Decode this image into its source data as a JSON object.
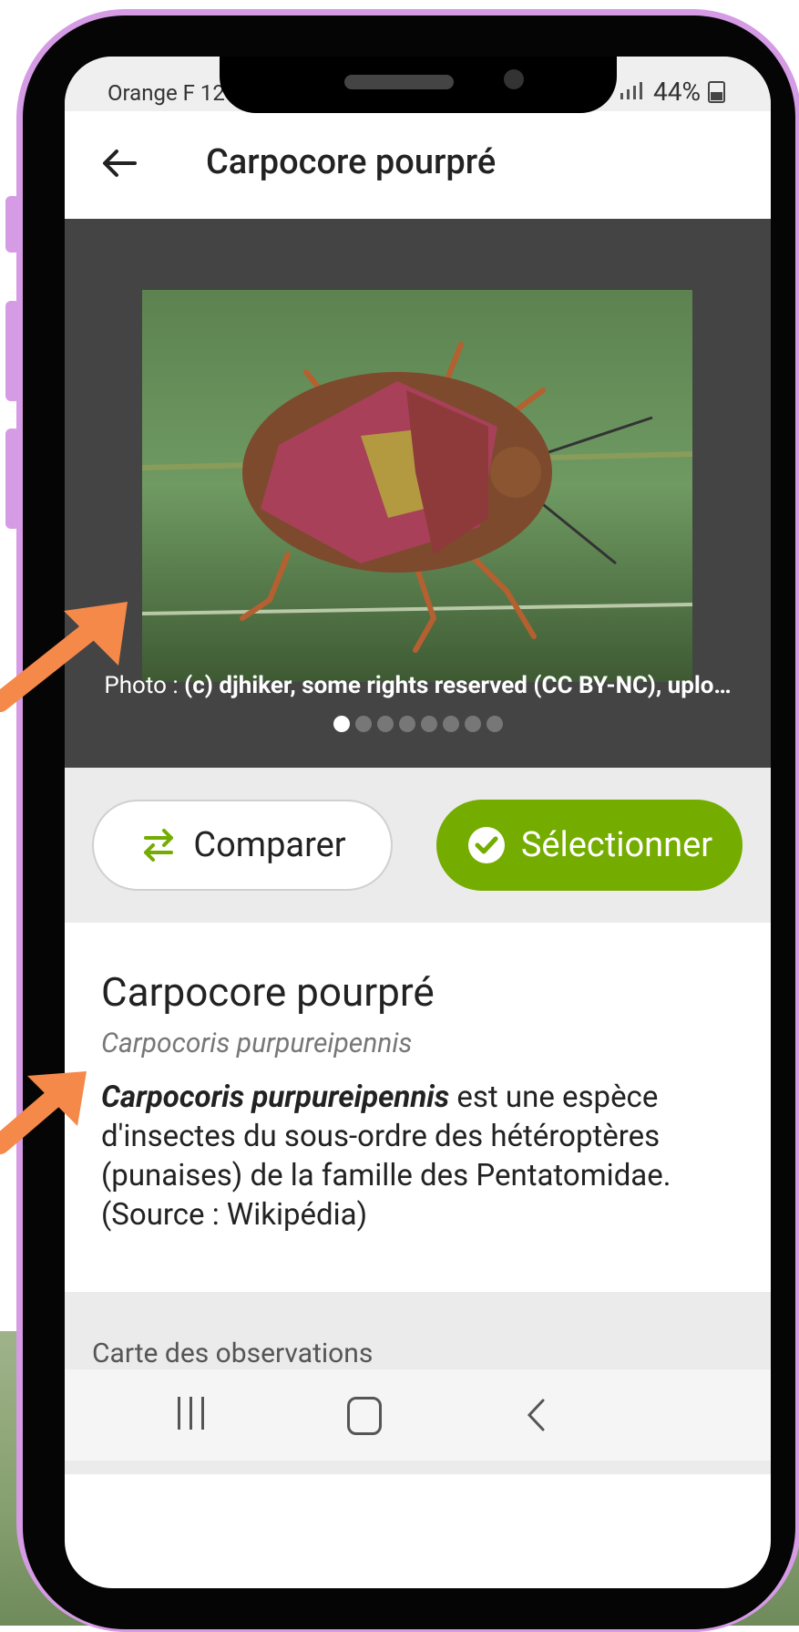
{
  "status_bar": {
    "carrier": "Orange F 12",
    "battery": "44%"
  },
  "header": {
    "title": "Carpocore pourpré"
  },
  "gallery": {
    "caption_prefix": "Photo : ",
    "caption_bold": "(c) djhiker, some rights reserved (CC BY-NC), uplo…",
    "dot_count": 8,
    "active_dot": 0
  },
  "actions": {
    "compare_label": "Comparer",
    "select_label": "Sélectionner"
  },
  "species": {
    "common_name": "Carpocore pourpré",
    "scientific_name": "Carpocoris purpureipennis",
    "description_bold": "Carpocoris purpureipennis",
    "description_rest": " est une espèce d'insectes du sous-ordre des hétéroptères (punaises) de la famille des Pentatomidae. (Source : Wikipédia)"
  },
  "map": {
    "label": "Carte des observations"
  },
  "colors": {
    "frame": "#d59be4",
    "accent": "#74ac00",
    "gallery_bg": "#444444",
    "arrow": "#f5894a"
  },
  "icons": [
    "back-arrow-icon",
    "swap-arrows-icon",
    "check-circle-icon",
    "signal-icon",
    "battery-icon",
    "nav-recent-icon",
    "nav-home-icon",
    "nav-back-icon"
  ]
}
